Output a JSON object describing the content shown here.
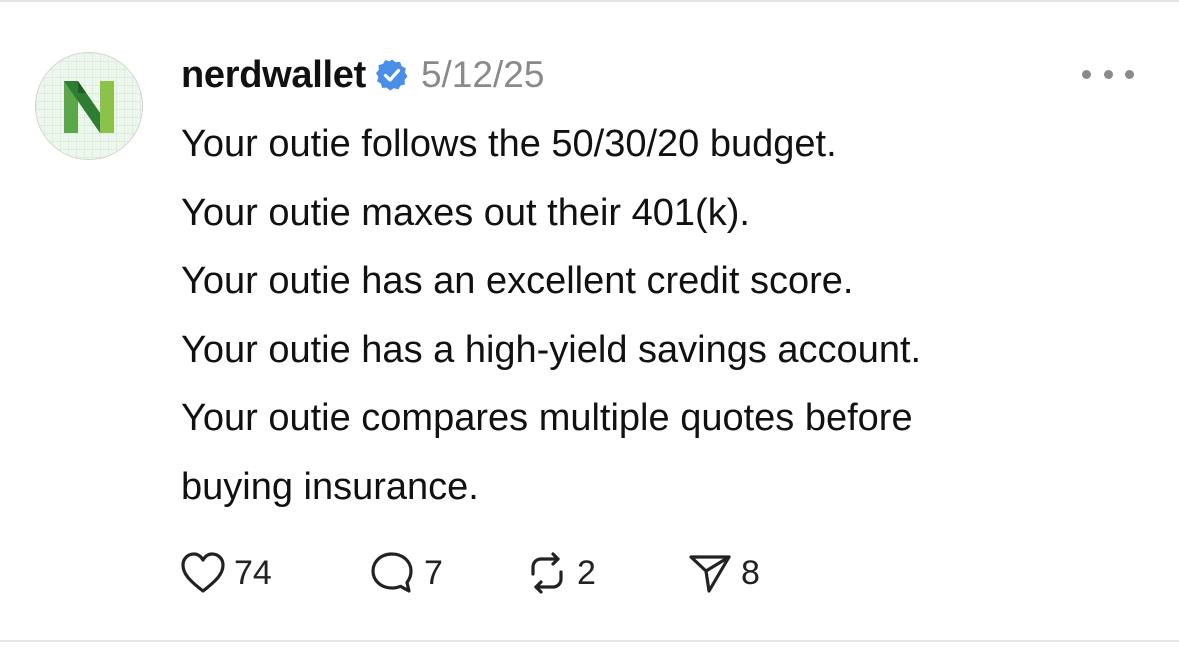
{
  "post": {
    "author": "nerdwallet",
    "verified": true,
    "date": "5/12/25",
    "avatar_icon": "nerdwallet-logo",
    "more_icon": "more-horizontal-icon",
    "lines": [
      "Your outie follows the 50/30/20 budget.",
      "Your outie maxes out their 401(k).",
      "Your outie has an excellent credit score.",
      "Your outie has a high-yield savings account.",
      "Your outie compares multiple quotes before",
      "buying insurance."
    ],
    "actions": {
      "likes": "74",
      "replies": "7",
      "reposts": "2",
      "shares": "8"
    }
  },
  "colors": {
    "verified_badge": "#4a8fe7",
    "logo_dark_green": "#2e7d32",
    "logo_light_green": "#8bc34a",
    "date_gray": "#8a8a8a"
  }
}
